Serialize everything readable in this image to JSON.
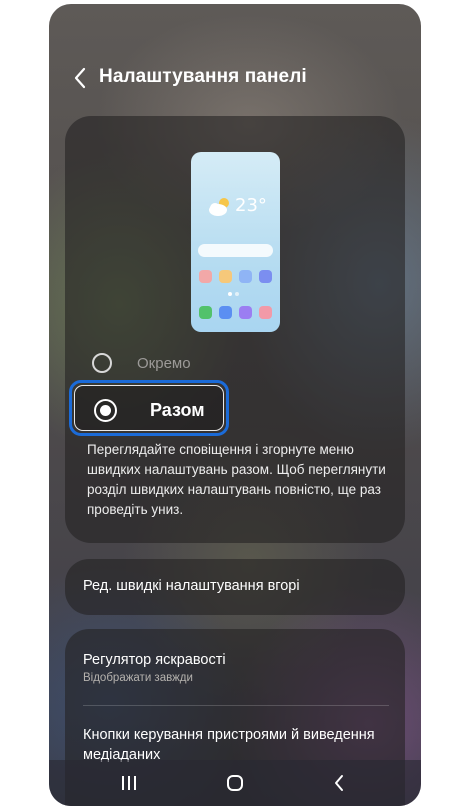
{
  "header": {
    "title": "Налаштування панелі"
  },
  "preview": {
    "temperature": "23°",
    "colors": {
      "row1": [
        "#f2a8a8",
        "#f6c87a",
        "#8fb4f5",
        "#7b8ef0"
      ],
      "row2": [
        "#52c26b",
        "#5b8ff2",
        "#9b7ef2",
        "#f29aa8"
      ]
    }
  },
  "options": {
    "separate_label": "Окремо",
    "together_label": "Разом",
    "selected": "together"
  },
  "description": "Переглядайте сповіщення і згорнуте меню швидких налаштувань разом. Щоб переглянути розділ швидких налаштувань повністю, ще раз проведіть униз.",
  "edit_card": {
    "label": "Ред. швидкі налаштування вгорі"
  },
  "list": {
    "brightness_title": "Регулятор яскравості",
    "brightness_subtitle": "Відображати завжди",
    "device_controls_title": "Кнопки керування пристроями й виведення медіаданих"
  },
  "navbar": {
    "recents_icon": "recents-icon",
    "home_icon": "home-icon",
    "back_icon": "back-icon"
  }
}
